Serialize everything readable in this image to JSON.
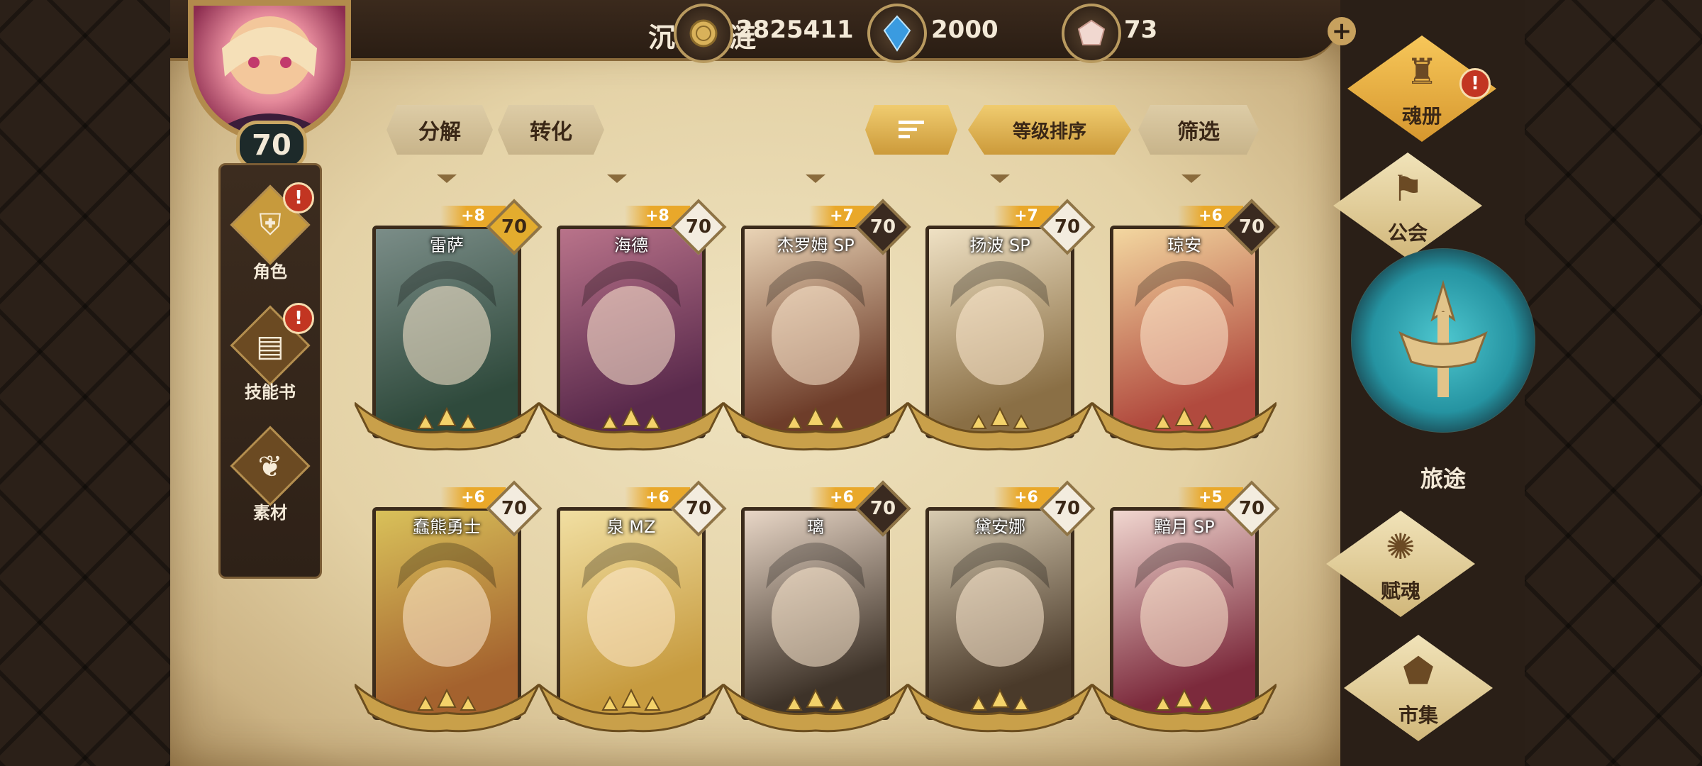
{
  "header": {
    "player_name": "沉睡的涟",
    "gold": "2825411",
    "crystal": "2000",
    "gem": "73",
    "add_label": "+"
  },
  "avatar": {
    "level": "70"
  },
  "left_menu": {
    "items": [
      {
        "label": "角色",
        "icon": "helmet-icon",
        "alert": "!"
      },
      {
        "label": "技能书",
        "icon": "skill-book-icon",
        "alert": "!"
      },
      {
        "label": "素材",
        "icon": "materials-icon"
      }
    ]
  },
  "toolbar": {
    "decompose": "分解",
    "convert": "转化",
    "sort_by_level": "等级排序",
    "filter": "筛选"
  },
  "cards": [
    {
      "name": "雷萨",
      "bonus": "+8",
      "level": "70",
      "badge": "gold",
      "colors": [
        "#2f4a3c",
        "#7b8d88"
      ]
    },
    {
      "name": "海德",
      "bonus": "+8",
      "level": "70",
      "badge": "white",
      "colors": [
        "#5a2a4c",
        "#b9738a"
      ]
    },
    {
      "name": "杰罗姆 SP",
      "bonus": "+7",
      "level": "70",
      "badge": "dark",
      "colors": [
        "#6e3d2a",
        "#e9d3b5"
      ]
    },
    {
      "name": "扬波 SP",
      "bonus": "+7",
      "level": "70",
      "badge": "white",
      "colors": [
        "#8a6f45",
        "#efe1c4"
      ]
    },
    {
      "name": "琼安",
      "bonus": "+6",
      "level": "70",
      "badge": "dark",
      "colors": [
        "#b14a3e",
        "#f3d7a0"
      ]
    },
    {
      "name": "蠢熊勇士",
      "bonus": "+6",
      "level": "70",
      "badge": "white",
      "colors": [
        "#a4622e",
        "#d9c15a"
      ]
    },
    {
      "name": "泉 MZ",
      "bonus": "+6",
      "level": "70",
      "badge": "white",
      "colors": [
        "#c79b3f",
        "#f1dfa2"
      ]
    },
    {
      "name": "璃",
      "bonus": "+6",
      "level": "70",
      "badge": "dark",
      "colors": [
        "#3e3329",
        "#e8d6c6"
      ]
    },
    {
      "name": "黛安娜",
      "bonus": "+6",
      "level": "70",
      "badge": "white",
      "colors": [
        "#4a3a2a",
        "#d8cbb1"
      ]
    },
    {
      "name": "黯月 SP",
      "bonus": "+5",
      "level": "70",
      "badge": "white",
      "colors": [
        "#7c2a3c",
        "#f1d7d0"
      ]
    }
  ],
  "right_menu": {
    "soul_book": "魂册",
    "guild": "公会",
    "journey": "旅途",
    "endow": "赋魂",
    "market": "市集",
    "soul_book_alert": "!"
  },
  "colors": {
    "parchment": "#e6d4a8",
    "frame_dark": "#2a1f17",
    "gold": "#e3ac2e",
    "alert_red": "#c23522",
    "journey_teal": "#2593a1"
  }
}
